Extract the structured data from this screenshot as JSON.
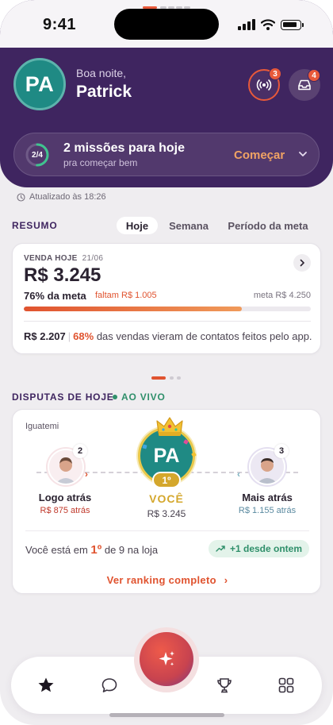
{
  "status_bar": {
    "time": "9:41"
  },
  "header": {
    "avatar_initials": "PA",
    "greeting": "Boa noite,",
    "user_name": "Patrick",
    "live_badge": "3",
    "inbox_badge": "4"
  },
  "missions": {
    "progress_label": "2/4",
    "progress": 0.5,
    "title": "2 missões para hoje",
    "subtitle": "pra começar bem",
    "cta": "Começar"
  },
  "updated_text": "Atualizado às 18:26",
  "resumo": {
    "section_title": "RESUMO",
    "tabs": [
      "Hoje",
      "Semana",
      "Período da meta"
    ],
    "active_tab": "Hoje",
    "label": "VENDA HOJE",
    "date": "21/06",
    "value": "R$ 3.245",
    "goal_pct": "76% da meta",
    "missing": "faltam R$ 1.005",
    "goal": "meta R$ 4.250",
    "progress": 0.76,
    "app_sales": "R$ 2.207",
    "app_pct": "68%",
    "app_text": "das vendas vieram de contatos feitos pelo app."
  },
  "disputas": {
    "section_title": "DISPUTAS DE HOJE",
    "live_label": "AO VIVO",
    "store": "Iguatemi",
    "left_rival": {
      "rank": "2",
      "label": "Logo atrás",
      "amount": "R$ 875 atrás"
    },
    "me": {
      "initials": "PA",
      "rank": "1º",
      "label": "VOCÊ",
      "amount": "R$ 3.245"
    },
    "right_rival": {
      "rank": "3",
      "label": "Mais atrás",
      "amount": "R$ 1.155 atrás"
    },
    "position_prefix": "Você está em",
    "position_rank": "1º",
    "position_suffix": "de 9 na loja",
    "delta": "+1 desde ontem",
    "ranking_link": "Ver ranking completo"
  },
  "nav": {
    "items": [
      "star-icon",
      "chat-icon",
      "sparkles-icon",
      "trophy-icon",
      "grid-icon"
    ]
  },
  "colors": {
    "brand_purple": "#3f2560",
    "accent_orange": "#e0532f",
    "live_green": "#2f8f6a",
    "gold": "#d4a72c",
    "avatar_teal": "#1f8a84"
  }
}
